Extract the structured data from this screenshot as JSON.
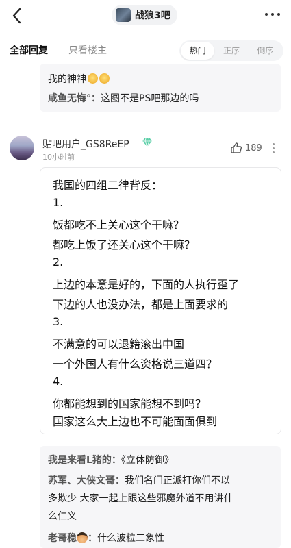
{
  "header": {
    "forum_name": "战狼3吧"
  },
  "tabs": {
    "all_replies": "全部回复",
    "op_only": "只看楼主",
    "sort": [
      "热门",
      "正序",
      "倒序"
    ],
    "sort_active": "热门"
  },
  "prev_subreplies": {
    "line1": "我的神神",
    "line2_user": "咸鱼无悔°：",
    "line2_text": "这图不是PS吧那边的吗"
  },
  "post": {
    "username": "贴吧用户_GS8ReEP",
    "time": "10小时前",
    "likes": "189",
    "lines": [
      "我国的四组二律背反：",
      "1.",
      "饭都吃不上关心这个干嘛？",
      "都吃上饭了还关心这个干嘛？",
      "2.",
      "上边的本意是好的，下面的人执行歪了",
      "下边的人也没办法，都是上面要求的",
      "3.",
      "不满意的可以退籍滚出中国",
      "一个外国人有什么资格说三道四？",
      "4.",
      "你都能想到的国家能想不到吗？",
      "国家这么大上边也不可能面面俱到"
    ]
  },
  "subreplies": {
    "r1_user": "我是来看L猪的：",
    "r1_text": "《立体防御》",
    "r2_user": "苏军、大侠文哥：",
    "r2_text_a": "我们名门正派打你们不以",
    "r2_text_b": "多欺少 大家一起上跟这些邪魔外道不用讲什",
    "r2_text_c": "么仁义",
    "r3_user": "老哥稳",
    "r3_sep": "：",
    "r3_text": "什么波粒二象性"
  },
  "icons": {
    "back": "chevron-left-icon",
    "more": "more-horizontal-icon",
    "like": "thumbs-up-icon",
    "kebab": "more-vertical-icon",
    "vip": "diamond-icon"
  },
  "colors": {
    "vip": "#5ccfa8",
    "subbox_bg": "#f6f6f8",
    "muted": "#999999"
  }
}
